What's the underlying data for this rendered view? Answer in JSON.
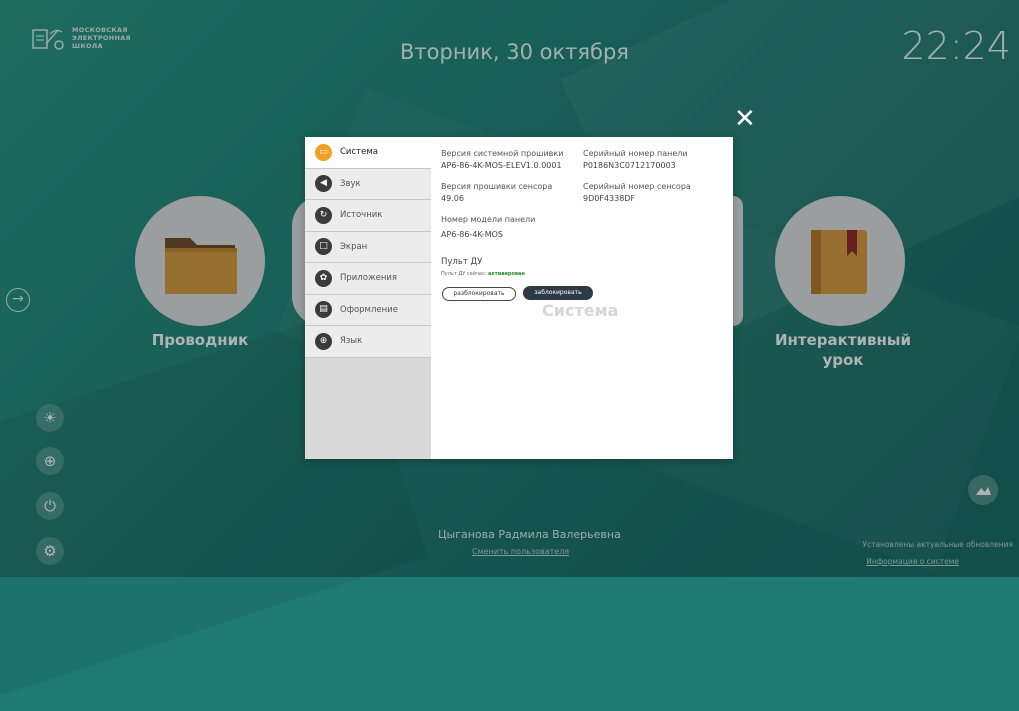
{
  "logo": {
    "line1": "МОСКОВСКАЯ",
    "line2": "ЭЛЕКТРОННАЯ",
    "line3": "ШКОЛА"
  },
  "date": "Вторник, 30 октября",
  "clock": "22:24",
  "apps": {
    "explorer": "Проводник",
    "lesson_line1": "Интерактивный",
    "lesson_line2": "урок"
  },
  "modal": {
    "menu": [
      {
        "label": "Система",
        "icon": "monitor-icon"
      },
      {
        "label": "Звук",
        "icon": "speaker-icon"
      },
      {
        "label": "Источник",
        "icon": "source-icon"
      },
      {
        "label": "Экран",
        "icon": "screen-icon"
      },
      {
        "label": "Приложения",
        "icon": "apps-icon"
      },
      {
        "label": "Оформление",
        "icon": "theme-icon"
      },
      {
        "label": "Язык",
        "icon": "globe-icon"
      }
    ],
    "fields": {
      "firmware_label": "Версия системной прошивки",
      "firmware_value": "AP6-86-4K-MOS-ELEV1.0.0001",
      "serial_label": "Серийный номер панели",
      "serial_value": "P0186N3C0712170003",
      "sensor_fw_label": "Версия прошивки сенсора",
      "sensor_fw_value": "49.06",
      "sensor_serial_label": "Серийный номер сенсора",
      "sensor_serial_value": "9D0F4338DF",
      "model_label": "Номер модели панели",
      "model_value": "AP6-86-4K-MOS"
    },
    "remote": {
      "title": "Пульт ДУ",
      "status_prefix": "Пульт ДУ сейчас:",
      "status_value": "активирован",
      "unlock_label": "разблокировать",
      "lock_label": "заблокировать"
    },
    "watermark": "Система",
    "close_symbol": "✕"
  },
  "footer": {
    "user_name": "Цыганова Радмила Валерьевна",
    "change_user": "Сменить пользователя",
    "updates": "Установлены актуальные обновления",
    "system_info": "Информация о системе"
  },
  "colors": {
    "accent": "#f0a024",
    "background": "#1f7b72",
    "button_dark": "#2f3a47"
  }
}
